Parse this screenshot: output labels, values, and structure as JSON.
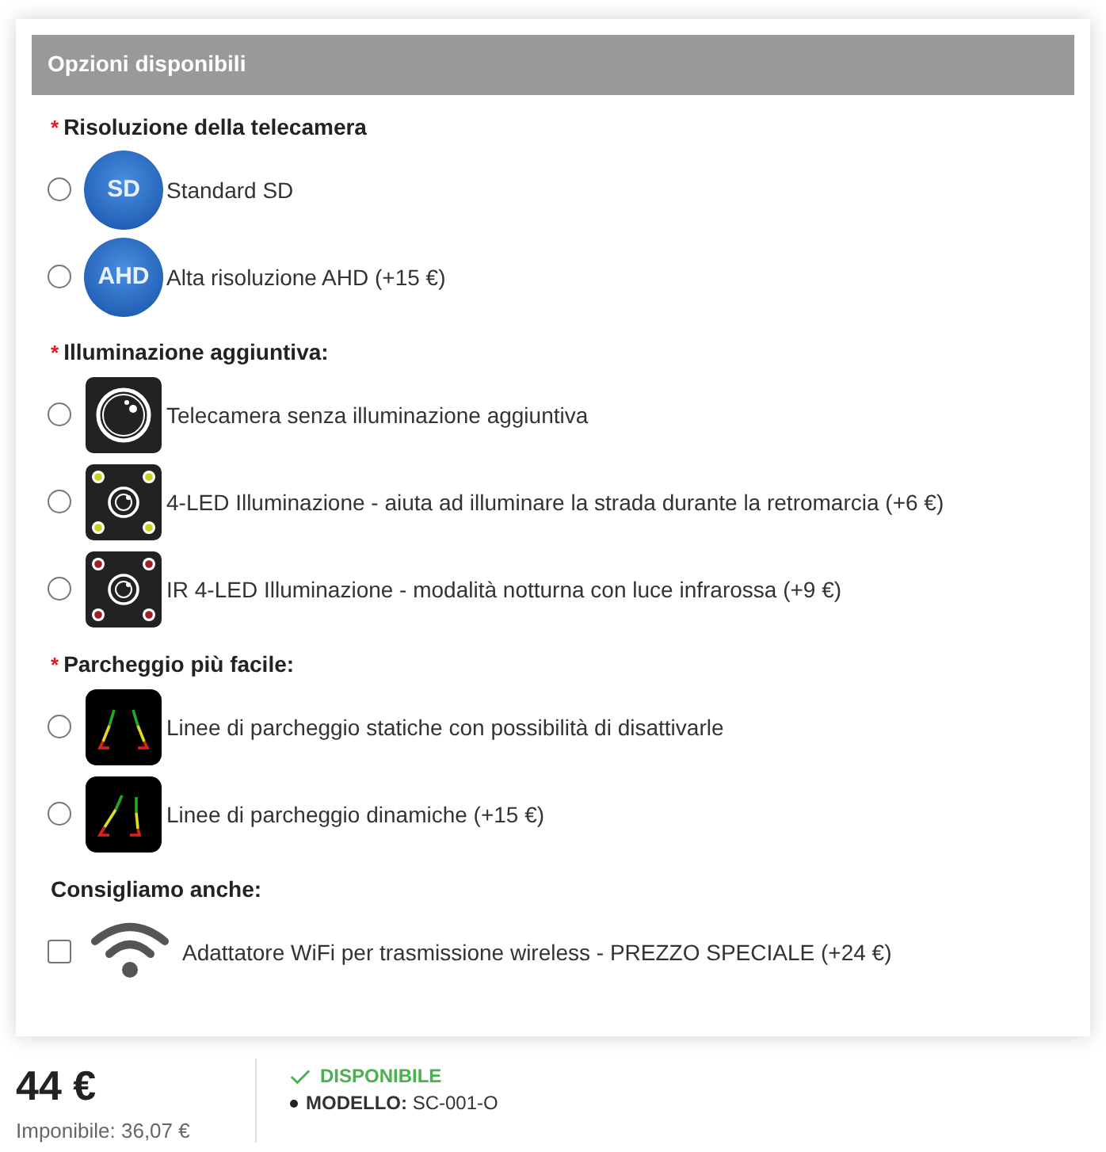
{
  "panel": {
    "title": "Opzioni disponibili"
  },
  "sections": [
    {
      "title": "Risoluzione della telecamera",
      "required_mark": "*",
      "kind": "radio",
      "options": [
        {
          "label": "Standard SD",
          "kind": "badge",
          "badge": "SD",
          "checked": false
        },
        {
          "label": "Alta risoluzione AHD (+15 €)",
          "kind": "badge",
          "badge": "AHD",
          "checked": false
        }
      ]
    },
    {
      "title": "Illuminazione aggiuntiva:",
      "required_mark": "*",
      "kind": "radio",
      "options": [
        {
          "label": "Telecamera senza illuminazione aggiuntiva",
          "kind": "camera",
          "checked": false
        },
        {
          "label": "4-LED Illuminazione - aiuta ad illuminare la strada durante la retromarcia (+6 €)",
          "kind": "led",
          "checked": false
        },
        {
          "label": "IR 4-LED Illuminazione - modalità notturna con luce infrarossa (+9 €)",
          "kind": "ir",
          "checked": false
        }
      ]
    },
    {
      "title": "Parcheggio più facile:",
      "required_mark": "*",
      "kind": "radio",
      "options": [
        {
          "label": "Linee di parcheggio statiche con possibilità di disattivarle",
          "kind": "static",
          "checked": false
        },
        {
          "label": "Linee di parcheggio dinamiche (+15 €)",
          "kind": "dynamic",
          "checked": false
        }
      ]
    },
    {
      "title": "Consigliamo anche:",
      "kind": "checkbox",
      "options": [
        {
          "label": "Adattatore WiFi per trasmissione wireless - PREZZO SPECIALE (+24 €)",
          "kind": "wifi",
          "checked": false
        }
      ]
    }
  ],
  "summary": {
    "price": "44 €",
    "net_price": "Imponibile: 36,07 €",
    "availability": "DISPONIBILE",
    "model": "**MODELLO:** SC-001-O"
  }
}
